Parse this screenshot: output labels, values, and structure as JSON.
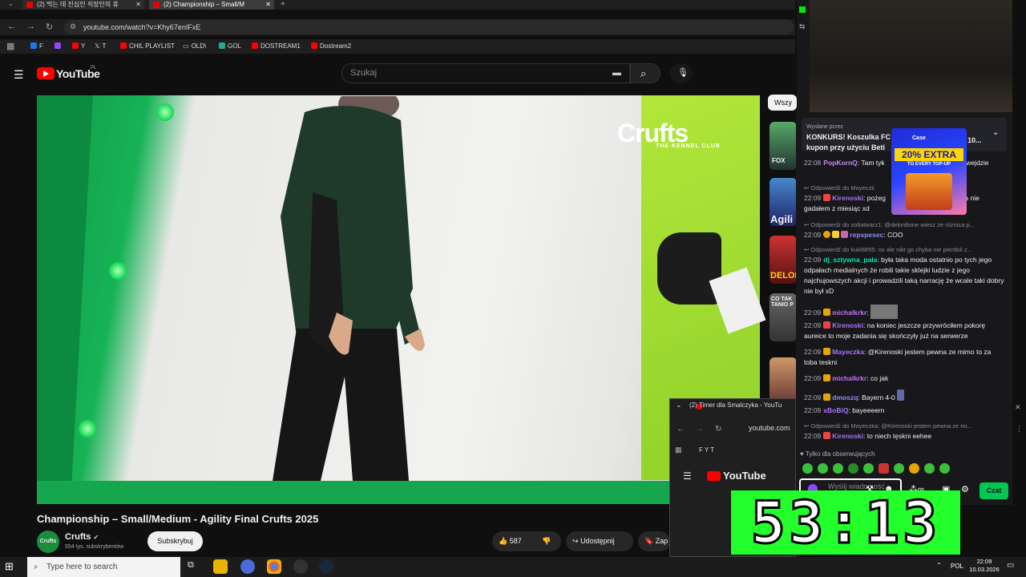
{
  "browser": {
    "tabs": [
      {
        "label": "(2) 먹는 데 진심인 직장인의 휴"
      },
      {
        "label": "(2) Championship – Small/M"
      }
    ],
    "url": "youtube.com/watch?v=Khy67enIFxE",
    "bookmarks": [
      "F",
      "",
      "Y",
      "T",
      "CHIL PLAYLIST",
      "OLD\\",
      "GOL",
      "DOSTREAM1",
      "Dostream2"
    ]
  },
  "youtube": {
    "logo_text": "YouTube",
    "logo_region": "PL",
    "search_placeholder": "Szukaj",
    "filter_chip": "Wszy",
    "video_overlay_brand": "Crufts",
    "video_overlay_sub": "THE KENNEL CLUB",
    "video_title": "Championship – Small/Medium - Agility Final Crufts 2025",
    "channel": {
      "name": "Crufts",
      "subscribers": "554 tys. subskrybentów",
      "avatar_text": "Crufts"
    },
    "subscribe_label": "Subskrybuj",
    "like_count": "587",
    "share_label": "Udostępnij",
    "save_label": "Zap",
    "side_thumbs": [
      {
        "text": "FOX"
      },
      {
        "text": "Agili"
      },
      {
        "text": "DELOR"
      },
      {
        "text": "CO TAK TANIO P"
      },
      {
        "text": ""
      }
    ]
  },
  "chat": {
    "pinned_header": "Wysłane przez",
    "pinned_text": "KONKURS! Koszulka FC",
    "pinned_text2": "kupon przy użyciu Beti",
    "pinned_tail": "10...",
    "ad": {
      "brand": "Case",
      "headline": "20% EXTRA",
      "sub": "TO EVERY TOP-UP"
    },
    "messages": [
      {
        "time": "22:08",
        "user": "PopKornQ",
        "color": "#c58af9",
        "text": "Tam tyk",
        "tail": "ie sie ze wejdzie",
        "reply": ""
      },
      {
        "time": "22:09",
        "user": "Kirenoski",
        "color": "#a970ff",
        "text": "pożeg",
        "tail": "tanim to ja nie gadałem z miesiąc xd",
        "reply": "Odpowiedź do Mayeczk"
      },
      {
        "time": "22:09",
        "user": "repspesec",
        "color": "#8a8aff",
        "text": "COO",
        "tail": "",
        "reply": "Odpowiedź do zoltatwarz1: @delordione wiesz że różnica p..."
      },
      {
        "time": "22:09",
        "user": "dj_sztywna_pała",
        "color": "#00e5b3",
        "text": "była taka moda ostatnio po tych jego odpałach medialnych że robili takie sklejki ludzie z jego najchujowszych akcji i prowadzili taką narrację że wcale taki dobry nie był xD",
        "tail": "",
        "reply": "Odpowiedź do kuki8855: no ale nikt go chyba nie pierdoli z..."
      },
      {
        "time": "22:09",
        "user": "michalkrkr",
        "color": "#c070ff",
        "text": "",
        "tail": "",
        "reply": ""
      },
      {
        "time": "22:09",
        "user": "Kirenoski",
        "color": "#a970ff",
        "text": "na koniec jeszcze przywróciłem pokorę aureice to moje zadania się skończyły już na serwerze",
        "tail": "",
        "reply": ""
      },
      {
        "time": "22:09",
        "user": "Mayeczka",
        "color": "#a970ff",
        "text": "@Kirenoski jestem pewna ze mimo to za toba teskni",
        "tail": "",
        "reply": ""
      },
      {
        "time": "22:09",
        "user": "michalkrkr",
        "color": "#c070ff",
        "text": "co jak",
        "tail": "",
        "reply": ""
      },
      {
        "time": "22:09",
        "user": "dmoszq",
        "color": "#8a8aff",
        "text": "Bayern 4-0",
        "tail": "",
        "reply": ""
      },
      {
        "time": "22:09",
        "user": "xBoBiQ",
        "color": "#a970ff",
        "text": "bayeeeern",
        "tail": "",
        "reply": ""
      },
      {
        "time": "22:09",
        "user": "Kirenoski",
        "color": "#a970ff",
        "text": "to niech tęskni eehee",
        "tail": "",
        "reply": "Odpowiedź do Mayeczka: @Kirenoski jestem pewna ze mi..."
      }
    ],
    "followers_only": "Tylko dla obserwujących",
    "input_placeholder": "Wyślij wiadomość",
    "send_label": "Czat"
  },
  "popup": {
    "title": "(2) Timer dla Smalczyka - YouTu",
    "url": "youtube.com",
    "bookmarks": "F    Y   T",
    "logo_text": "YouTube",
    "timer": "53:13"
  },
  "taskbar": {
    "search_placeholder": "Type here to search",
    "lang": "POL",
    "time": "22:09",
    "date": "10.03.2026"
  }
}
